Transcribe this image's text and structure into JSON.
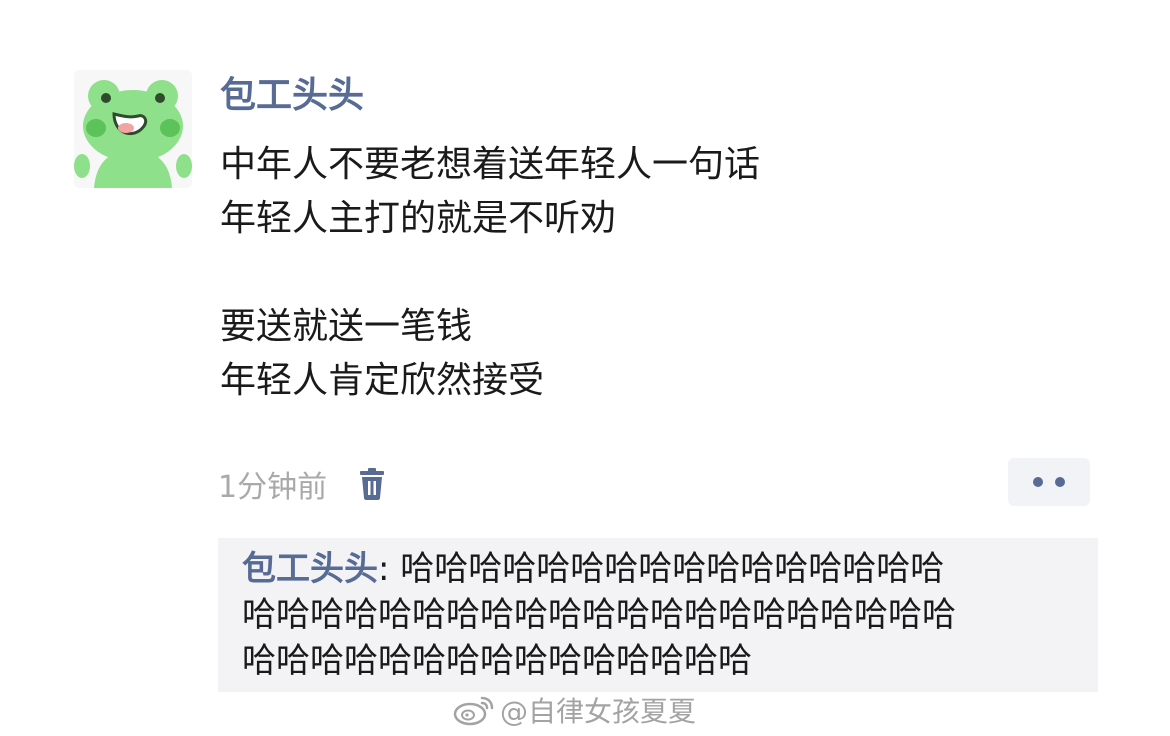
{
  "post": {
    "author": "包工头头",
    "lines": [
      "中年人不要老想着送年轻人一句话",
      "年轻人主打的就是不听劝",
      "",
      "要送就送一笔钱",
      "年轻人肯定欣然接受"
    ],
    "timestamp": "1分钟前",
    "delete_icon": "trash-icon",
    "more_icon": "ellipsis-icon"
  },
  "comment": {
    "author": "包工头头",
    "separator": ": ",
    "line1": "哈哈哈哈哈哈哈哈哈哈哈哈哈哈哈哈",
    "line2": "哈哈哈哈哈哈哈哈哈哈哈哈哈哈哈哈哈哈哈哈哈",
    "line3": "哈哈哈哈哈哈哈哈哈哈哈哈哈哈哈"
  },
  "watermark": {
    "text": "@自律女孩夏夏",
    "logo_icon": "weibo-logo-icon"
  },
  "colors": {
    "link_blue": "#576b95",
    "text": "#1a1a1a",
    "meta_gray": "#a9a9a9",
    "comment_bg": "#f3f3f5",
    "avatar_green": "#7fd87a"
  }
}
